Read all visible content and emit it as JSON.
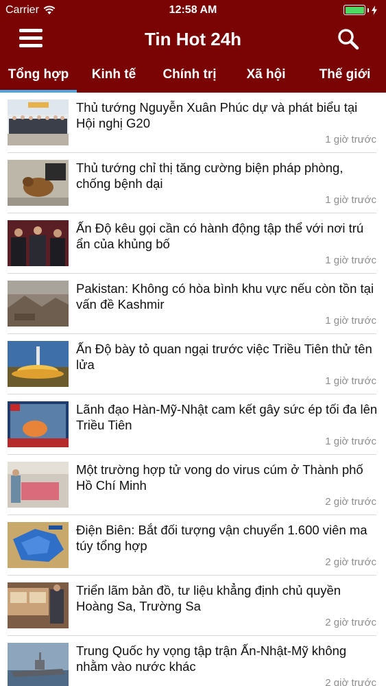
{
  "status_bar": {
    "carrier": "Carrier",
    "time": "12:58 AM",
    "battery_level": 1.0,
    "battery_color": "#4cd964",
    "wifi_icon": "wifi-icon",
    "charging_icon": "bolt-icon"
  },
  "header": {
    "title": "Tin Hot 24h",
    "menu_icon": "hamburger-menu-icon",
    "search_icon": "search-icon",
    "background_color": "#7a0404"
  },
  "tabs": [
    {
      "label": "Tổng hợp",
      "active": true
    },
    {
      "label": "Kinh tế",
      "active": false
    },
    {
      "label": "Chính trị",
      "active": false
    },
    {
      "label": "Xã hội",
      "active": false
    },
    {
      "label": "Thế giới",
      "active": false
    }
  ],
  "tab_indicator_color": "#4ea6dc",
  "articles": [
    {
      "title": "Thủ tướng Nguyễn Xuân Phúc dự và phát biểu tại Hội nghị G20",
      "time": "1 giờ trước"
    },
    {
      "title": "Thủ tướng chỉ thị tăng cường biện pháp phòng, chống bệnh dại",
      "time": "1 giờ trước"
    },
    {
      "title": "Ấn Độ kêu gọi cần có hành động tập thể với nơi trú ẩn của khủng bố",
      "time": "1 giờ trước"
    },
    {
      "title": "Pakistan: Không có hòa bình khu vực nếu còn tồn tại vấn đề Kashmir",
      "time": "1 giờ trước"
    },
    {
      "title": "Ấn Độ bày tỏ quan ngại trước việc Triều Tiên thử tên lửa",
      "time": "1 giờ trước"
    },
    {
      "title": "Lãnh đạo Hàn-Mỹ-Nhật cam kết gây sức ép tối đa lên Triều Tiên",
      "time": "1 giờ trước"
    },
    {
      "title": "Một trường hợp tử vong do virus cúm ở Thành phố Hồ Chí Minh",
      "time": "2 giờ trước"
    },
    {
      "title": "Điện Biên: Bắt đối tượng vận chuyển 1.600 viên ma túy tổng hợp",
      "time": "2 giờ trước"
    },
    {
      "title": "Triển lãm bản đồ, tư liệu khẳng định chủ quyền Hoàng Sa, Trường Sa",
      "time": "2 giờ trước"
    },
    {
      "title": "Trung Quốc hy vọng tập trận Ấn-Nhật-Mỹ không nhằm vào nước khác",
      "time": "2 giờ trước"
    }
  ]
}
